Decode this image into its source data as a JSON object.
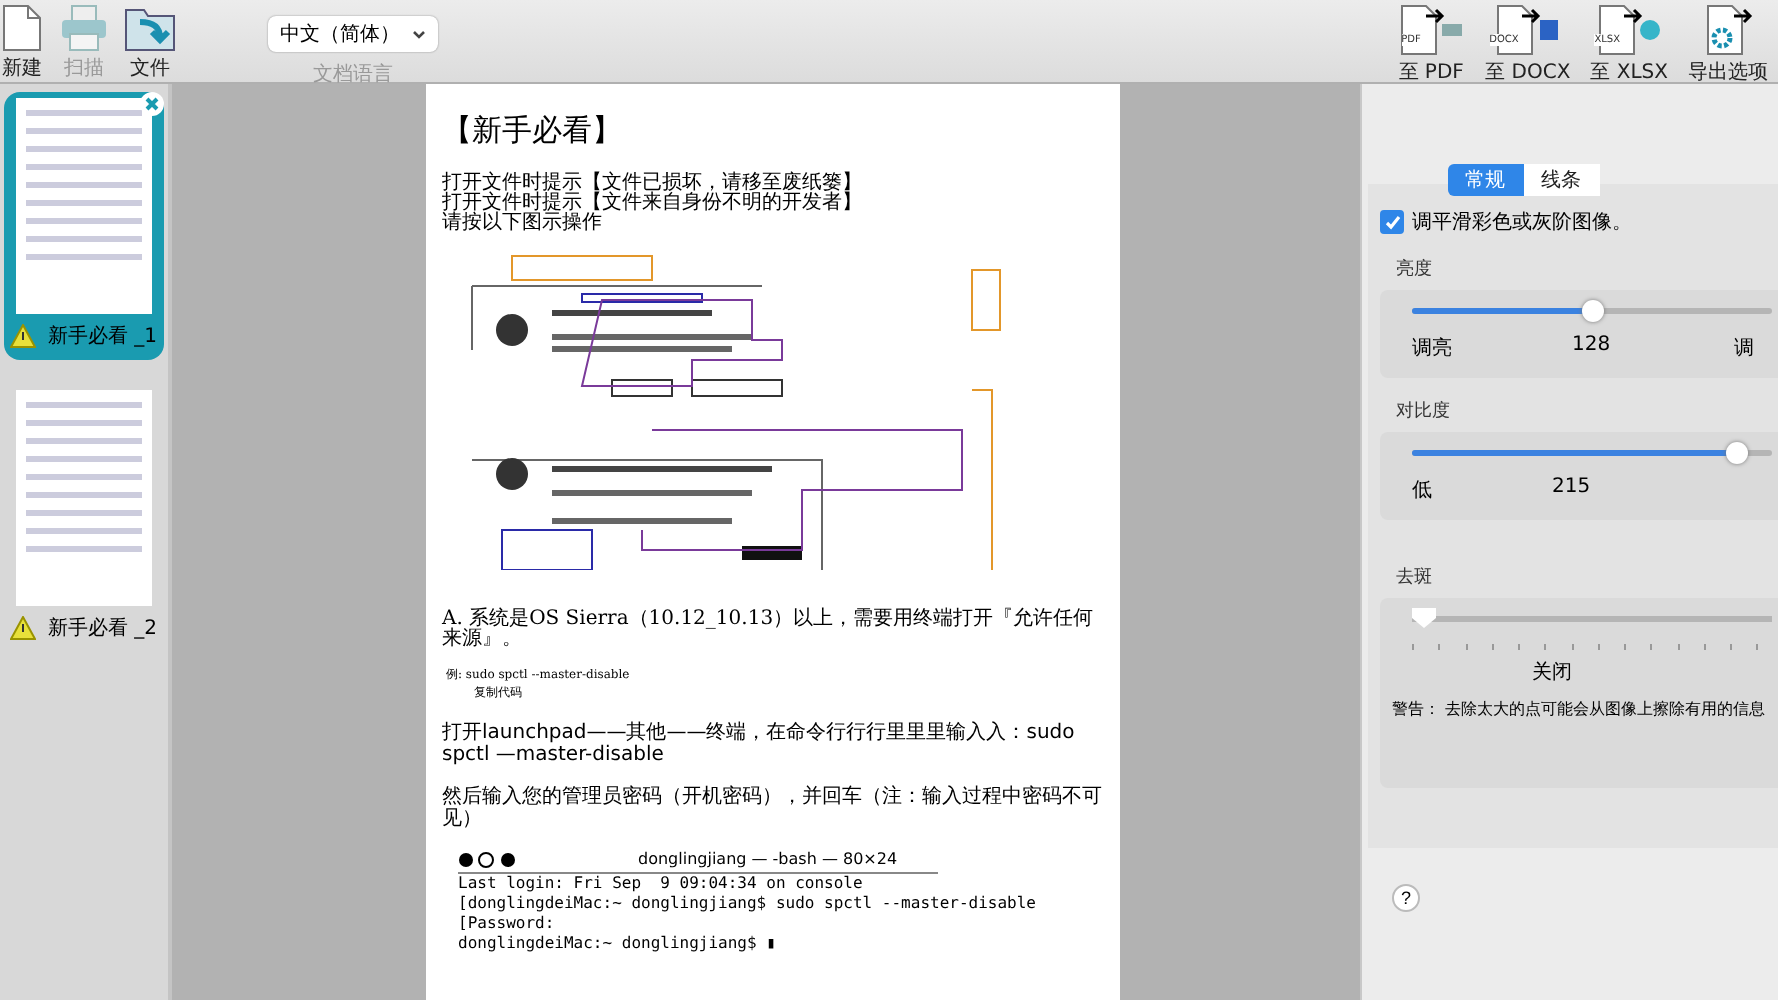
{
  "toolbar": {
    "left_buttons": [
      {
        "kind": "new",
        "label": "新建",
        "disabled": false
      },
      {
        "kind": "scan",
        "label": "扫描",
        "disabled": true
      },
      {
        "kind": "file",
        "label": "文件",
        "disabled": false
      }
    ],
    "language": {
      "value": "中文（简体）",
      "label": "文档语言"
    },
    "export_buttons": [
      {
        "kind": "pdf",
        "label": "至 PDF",
        "badge": "PDF"
      },
      {
        "kind": "docx",
        "label": "至 DOCX",
        "badge": "DOCX"
      },
      {
        "kind": "xlsx",
        "label": "至 XLSX",
        "badge": "XLSX"
      },
      {
        "kind": "options",
        "label": "导出选项"
      }
    ]
  },
  "pages": [
    {
      "label": "新手必看 _1",
      "selected": true,
      "warning": true
    },
    {
      "label": "新手必看 _2",
      "selected": false,
      "warning": true
    }
  ],
  "document": {
    "title": "【新手必看】",
    "intro_lines": [
      "打开文件时提示【文件已损坏，请移至废纸篓】",
      "打开文件时提示【文件来自身份不明的开发者】",
      "请按以下图示操作"
    ],
    "instruction": "A. 系统是OS Sierra（10.12_10.13）以上，需要用终端打开『允许任何来源』。",
    "example": "例:   sudo spctl --master-disable",
    "example_note": "复制代码",
    "steps": [
      "打开launchpad——其他——终端，在命令行行行里里里输入入：sudo spctl —master-disable",
      "然后输入您的管理员密码（开机密码），并回车（注：输入过程中密码不可见）"
    ],
    "terminal": {
      "title": "donglingjiang — -bash — 80×24",
      "lines": [
        "Last login: Fri Sep  9 09:04:34 on console",
        "[donglingdeiMac:~ donglingjiang$ sudo spctl --master-disable",
        "[Password:",
        "donglingdeiMac:~ donglingjiang$ ▮"
      ]
    }
  },
  "settings": {
    "tabs": [
      {
        "label": "常规",
        "selected": true
      },
      {
        "label": "线条",
        "selected": false
      }
    ],
    "smoothing": {
      "label": "调平滑彩色或灰阶图像。",
      "checked": true
    },
    "brightness": {
      "label": "亮度",
      "level": 0.5,
      "min_label": "调亮",
      "value": "128",
      "max_label": "调"
    },
    "contrast": {
      "label": "对比度",
      "level": 0.9,
      "min_label": "低",
      "value": "215"
    },
    "despeckle": {
      "label": "去斑",
      "level": 0,
      "value": "关闭",
      "warning": "警告： 去除太大的点可能会从图像上擦除有用的信息"
    },
    "help": "?"
  }
}
